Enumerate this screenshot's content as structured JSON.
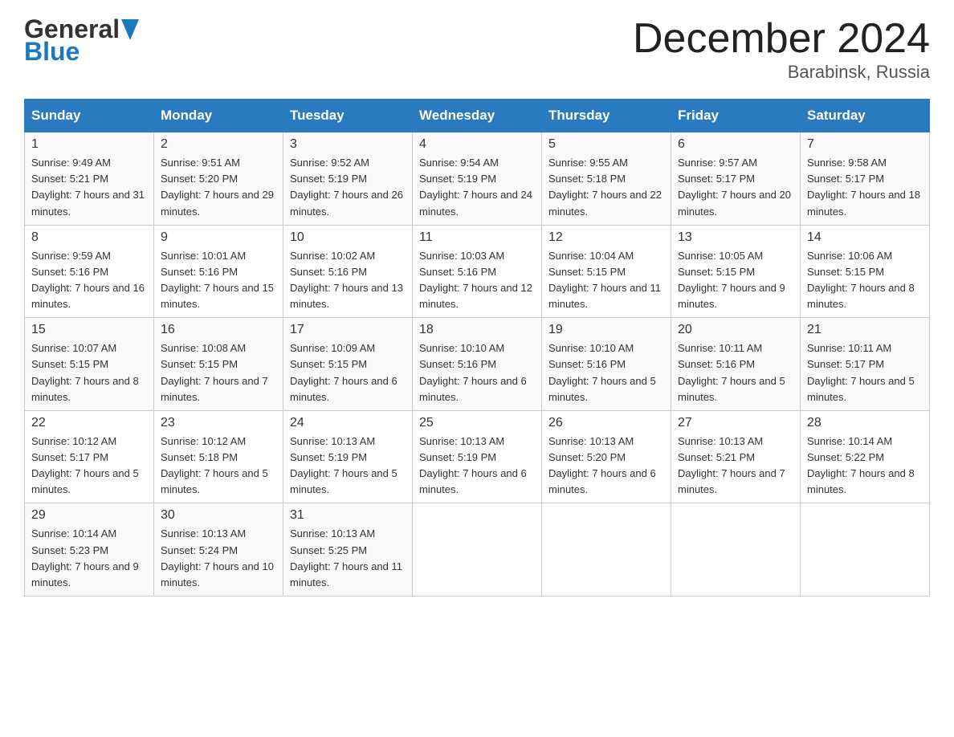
{
  "header": {
    "logo_general": "General",
    "logo_blue": "Blue",
    "month_title": "December 2024",
    "location": "Barabinsk, Russia"
  },
  "weekdays": [
    "Sunday",
    "Monday",
    "Tuesday",
    "Wednesday",
    "Thursday",
    "Friday",
    "Saturday"
  ],
  "weeks": [
    [
      {
        "day": "1",
        "sunrise": "9:49 AM",
        "sunset": "5:21 PM",
        "daylight": "7 hours and 31 minutes."
      },
      {
        "day": "2",
        "sunrise": "9:51 AM",
        "sunset": "5:20 PM",
        "daylight": "7 hours and 29 minutes."
      },
      {
        "day": "3",
        "sunrise": "9:52 AM",
        "sunset": "5:19 PM",
        "daylight": "7 hours and 26 minutes."
      },
      {
        "day": "4",
        "sunrise": "9:54 AM",
        "sunset": "5:19 PM",
        "daylight": "7 hours and 24 minutes."
      },
      {
        "day": "5",
        "sunrise": "9:55 AM",
        "sunset": "5:18 PM",
        "daylight": "7 hours and 22 minutes."
      },
      {
        "day": "6",
        "sunrise": "9:57 AM",
        "sunset": "5:17 PM",
        "daylight": "7 hours and 20 minutes."
      },
      {
        "day": "7",
        "sunrise": "9:58 AM",
        "sunset": "5:17 PM",
        "daylight": "7 hours and 18 minutes."
      }
    ],
    [
      {
        "day": "8",
        "sunrise": "9:59 AM",
        "sunset": "5:16 PM",
        "daylight": "7 hours and 16 minutes."
      },
      {
        "day": "9",
        "sunrise": "10:01 AM",
        "sunset": "5:16 PM",
        "daylight": "7 hours and 15 minutes."
      },
      {
        "day": "10",
        "sunrise": "10:02 AM",
        "sunset": "5:16 PM",
        "daylight": "7 hours and 13 minutes."
      },
      {
        "day": "11",
        "sunrise": "10:03 AM",
        "sunset": "5:16 PM",
        "daylight": "7 hours and 12 minutes."
      },
      {
        "day": "12",
        "sunrise": "10:04 AM",
        "sunset": "5:15 PM",
        "daylight": "7 hours and 11 minutes."
      },
      {
        "day": "13",
        "sunrise": "10:05 AM",
        "sunset": "5:15 PM",
        "daylight": "7 hours and 9 minutes."
      },
      {
        "day": "14",
        "sunrise": "10:06 AM",
        "sunset": "5:15 PM",
        "daylight": "7 hours and 8 minutes."
      }
    ],
    [
      {
        "day": "15",
        "sunrise": "10:07 AM",
        "sunset": "5:15 PM",
        "daylight": "7 hours and 8 minutes."
      },
      {
        "day": "16",
        "sunrise": "10:08 AM",
        "sunset": "5:15 PM",
        "daylight": "7 hours and 7 minutes."
      },
      {
        "day": "17",
        "sunrise": "10:09 AM",
        "sunset": "5:15 PM",
        "daylight": "7 hours and 6 minutes."
      },
      {
        "day": "18",
        "sunrise": "10:10 AM",
        "sunset": "5:16 PM",
        "daylight": "7 hours and 6 minutes."
      },
      {
        "day": "19",
        "sunrise": "10:10 AM",
        "sunset": "5:16 PM",
        "daylight": "7 hours and 5 minutes."
      },
      {
        "day": "20",
        "sunrise": "10:11 AM",
        "sunset": "5:16 PM",
        "daylight": "7 hours and 5 minutes."
      },
      {
        "day": "21",
        "sunrise": "10:11 AM",
        "sunset": "5:17 PM",
        "daylight": "7 hours and 5 minutes."
      }
    ],
    [
      {
        "day": "22",
        "sunrise": "10:12 AM",
        "sunset": "5:17 PM",
        "daylight": "7 hours and 5 minutes."
      },
      {
        "day": "23",
        "sunrise": "10:12 AM",
        "sunset": "5:18 PM",
        "daylight": "7 hours and 5 minutes."
      },
      {
        "day": "24",
        "sunrise": "10:13 AM",
        "sunset": "5:19 PM",
        "daylight": "7 hours and 5 minutes."
      },
      {
        "day": "25",
        "sunrise": "10:13 AM",
        "sunset": "5:19 PM",
        "daylight": "7 hours and 6 minutes."
      },
      {
        "day": "26",
        "sunrise": "10:13 AM",
        "sunset": "5:20 PM",
        "daylight": "7 hours and 6 minutes."
      },
      {
        "day": "27",
        "sunrise": "10:13 AM",
        "sunset": "5:21 PM",
        "daylight": "7 hours and 7 minutes."
      },
      {
        "day": "28",
        "sunrise": "10:14 AM",
        "sunset": "5:22 PM",
        "daylight": "7 hours and 8 minutes."
      }
    ],
    [
      {
        "day": "29",
        "sunrise": "10:14 AM",
        "sunset": "5:23 PM",
        "daylight": "7 hours and 9 minutes."
      },
      {
        "day": "30",
        "sunrise": "10:13 AM",
        "sunset": "5:24 PM",
        "daylight": "7 hours and 10 minutes."
      },
      {
        "day": "31",
        "sunrise": "10:13 AM",
        "sunset": "5:25 PM",
        "daylight": "7 hours and 11 minutes."
      },
      null,
      null,
      null,
      null
    ]
  ]
}
